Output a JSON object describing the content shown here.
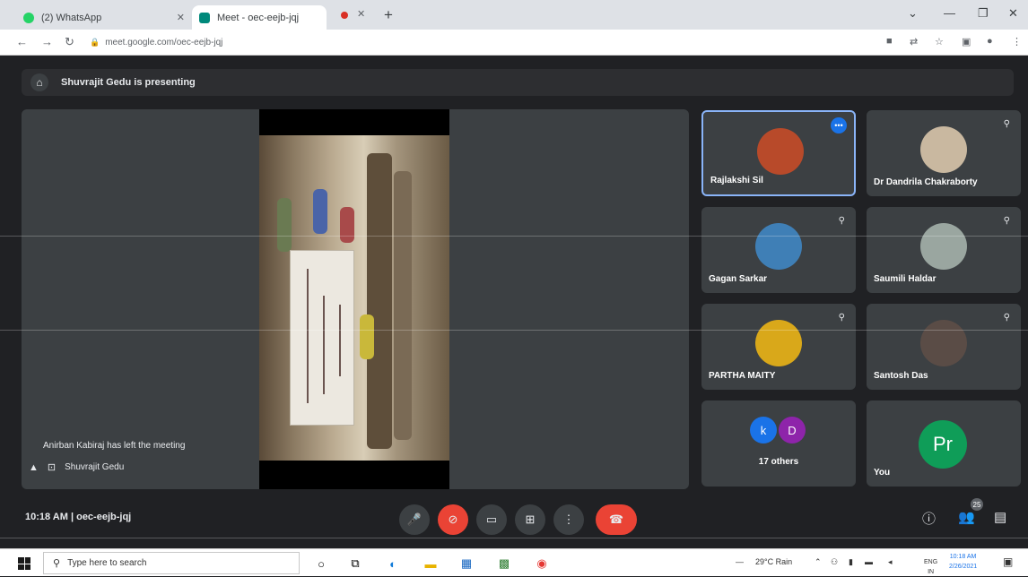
{
  "browser": {
    "tabs": [
      {
        "title": "(2) WhatsApp",
        "favicon_color": "#25d366"
      },
      {
        "title": "Meet - oec-eejb-jqj",
        "favicon_color": "#00897b"
      }
    ],
    "url": "meet.google.com/oec-eejb-jqj"
  },
  "meeting": {
    "presenter_banner": "Shuvrajit Gedu is presenting",
    "notification": "Anirban Kabiraj has left the meeting",
    "presentation_label": "Shuvrajit Gedu",
    "time": "10:18 AM",
    "separator": "|",
    "code": "oec-eejb-jqj",
    "participants": [
      {
        "name": "Rajlakshi Sil",
        "active": true,
        "avatar_color": "#b84a2a"
      },
      {
        "name": "Dr Dandrila Chakraborty",
        "active": false,
        "avatar_color": "#c9b8a0"
      },
      {
        "name": "Gagan Sarkar",
        "active": false,
        "avatar_color": "#3f7fb6"
      },
      {
        "name": "Saumili Haldar",
        "active": false,
        "avatar_color": "#9aa6a0"
      },
      {
        "name": "PARTHA MAITY",
        "active": false,
        "avatar_color": "#d9a81a"
      },
      {
        "name": "Santosh Das",
        "active": false,
        "avatar_color": "#5a4c46"
      }
    ],
    "others_tile": {
      "chip1": "k",
      "chip2": "D",
      "label": "17 others"
    },
    "self_tile": {
      "initials": "Pr",
      "name": "You"
    },
    "people_count": "25"
  },
  "taskbar": {
    "search_placeholder": "Type here to search",
    "weather": "29°C Rain",
    "lang": "ENG",
    "region": "IN",
    "time": "10:18 AM",
    "date": "2/26/2021"
  }
}
